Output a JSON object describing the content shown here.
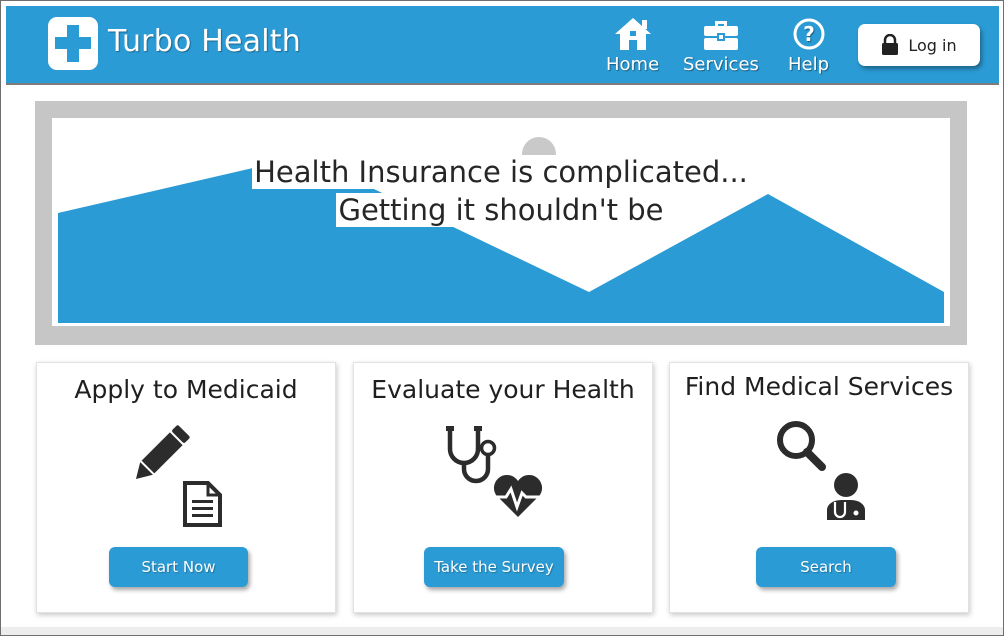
{
  "app": {
    "brand": "Turbo Health"
  },
  "nav": {
    "items": [
      {
        "label": "Home",
        "icon": "home-icon"
      },
      {
        "label": "Services",
        "icon": "briefcase-icon"
      },
      {
        "label": "Help",
        "icon": "help-icon"
      }
    ],
    "login_label": "Log in"
  },
  "hero": {
    "line1": "Health Insurance is complicated...",
    "line2": "Getting it shouldn't be"
  },
  "cards": [
    {
      "title": "Apply to Medicaid",
      "icon": "pencil-document-icon",
      "button": "Start Now"
    },
    {
      "title": "Evaluate your Health",
      "icon": "stethoscope-heart-icon",
      "button": "Take the Survey"
    },
    {
      "title": "Find Medical Services",
      "icon": "search-doctor-icon",
      "button": "Search"
    }
  ],
  "colors": {
    "accent": "#2b9bd5",
    "hero_frame": "#c6c6c6",
    "text": "#1f1f1f"
  }
}
